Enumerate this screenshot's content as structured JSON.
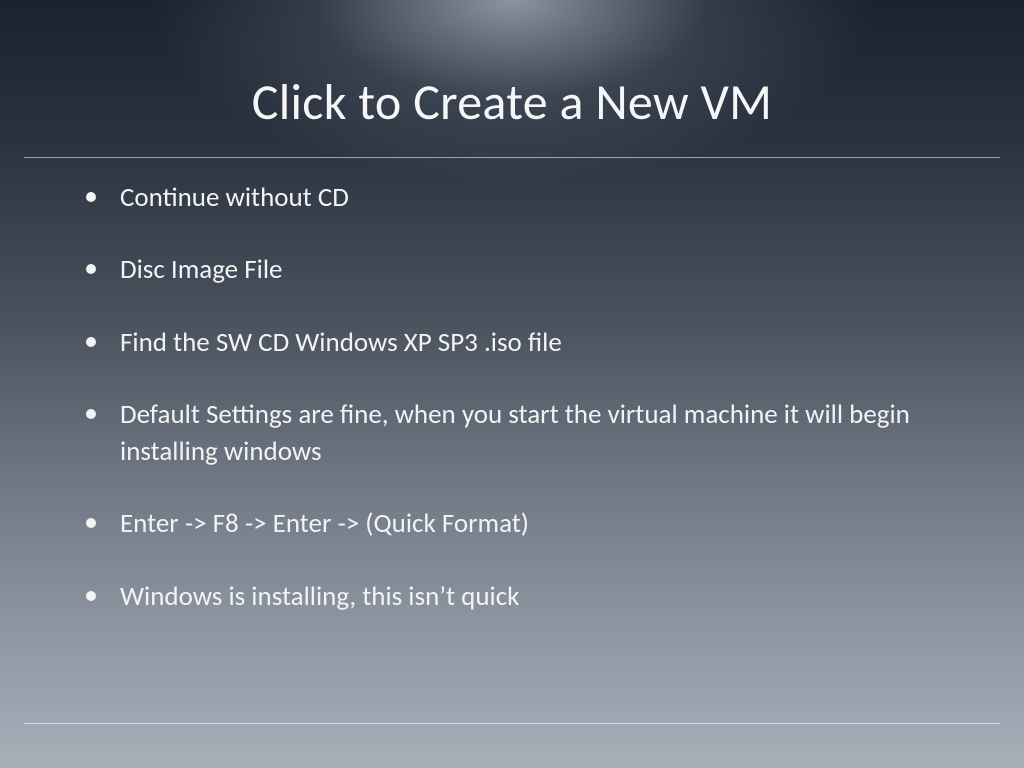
{
  "title": "Click to Create a New VM",
  "bullets": [
    "Continue without CD",
    "Disc Image File",
    "Find the SW CD Windows XP SP3 .iso file",
    "Default Settings are fine, when you start the virtual machine it will begin installing windows",
    "Enter -> F8 -> Enter -> (Quick Format)",
    "Windows is installing, this isn’t quick"
  ]
}
